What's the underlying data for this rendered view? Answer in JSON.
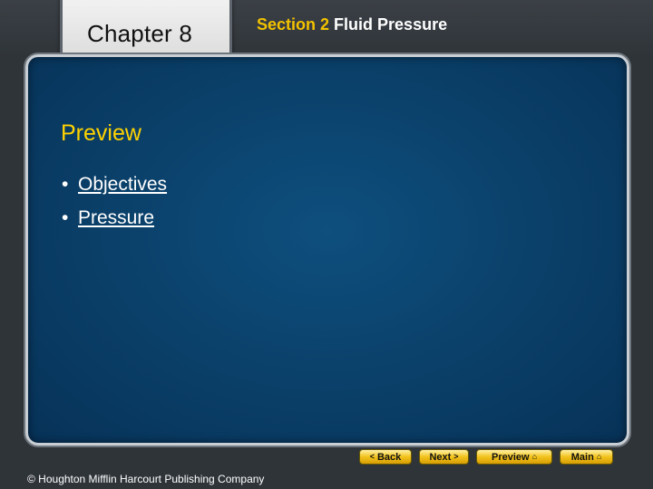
{
  "header": {
    "chapter": "Chapter 8",
    "section_prefix": "Section 2",
    "section_title": "Fluid Pressure"
  },
  "content": {
    "heading": "Preview",
    "bullets": [
      {
        "marker": "•",
        "label": "Objectives"
      },
      {
        "marker": "•",
        "label": "Pressure"
      }
    ]
  },
  "nav": {
    "back": {
      "label": "Back",
      "icon": "chevron-left-icon"
    },
    "next": {
      "label": "Next",
      "icon": "chevron-right-icon"
    },
    "preview": {
      "label": "Preview",
      "icon": "home-icon"
    },
    "main": {
      "label": "Main",
      "icon": "home-icon"
    }
  },
  "footer": {
    "copyright": "© Houghton Mifflin Harcourt Publishing Company"
  },
  "colors": {
    "accent_yellow": "#ffd200",
    "section_number": "#f2c200",
    "panel_blue": "#0a3f68"
  }
}
